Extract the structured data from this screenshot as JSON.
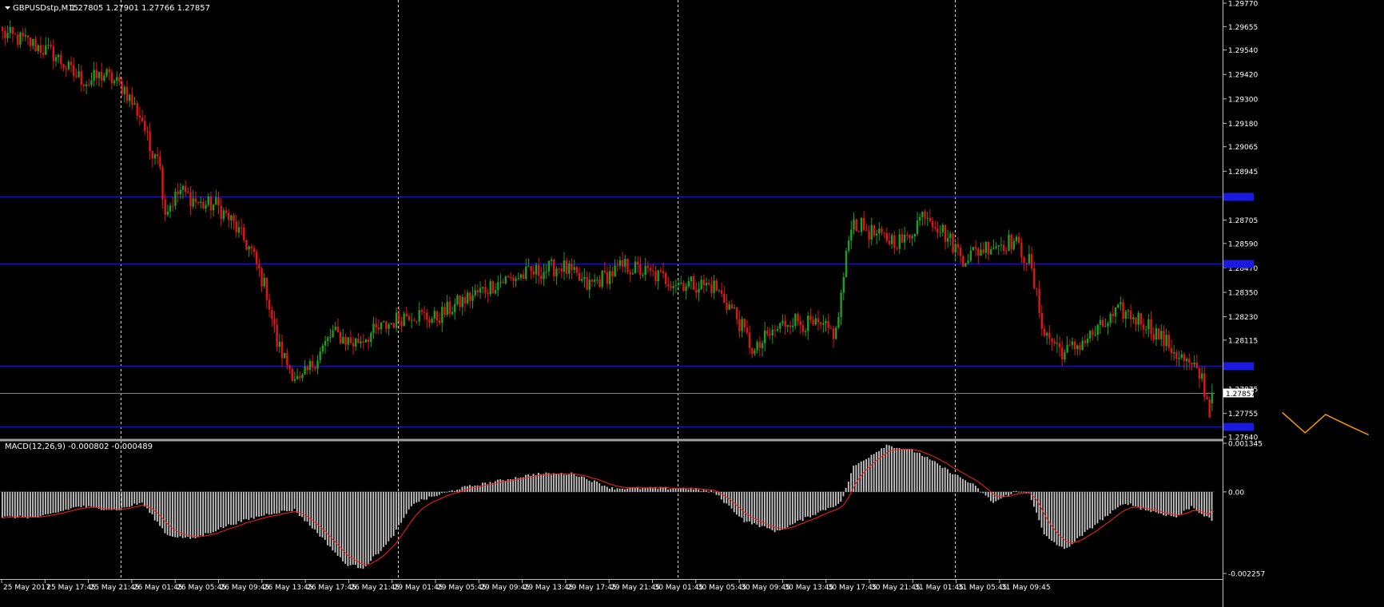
{
  "window": {
    "symbol_timeframe": "GBPUSDstp,M15",
    "ohlc_readout": "1.27805 1.27901 1.27766 1.27857",
    "dropdown_icon": "triangle-down-icon"
  },
  "colors": {
    "background": "#000000",
    "bull": "#1ea01e",
    "bear": "#e41414",
    "hline": "#1010e6",
    "hline_tag": "#1a1ae0",
    "period_sep": "#ffffff",
    "macd_hist": "#c8c8c8",
    "macd_signal": "#ff2020",
    "projection": "#ff9a00",
    "axis": "#c0c0c0",
    "current_price_line": "#808080",
    "current_price_tag_bg": "#ffffff",
    "current_price_tag_text": "#000000"
  },
  "main_chart": {
    "price_ticks": [
      "1.29770",
      "1.29655",
      "1.29540",
      "1.29420",
      "1.29300",
      "1.29180",
      "1.29065",
      "1.28945",
      "1.28705",
      "1.28590",
      "1.28470",
      "1.28350",
      "1.28230",
      "1.28115",
      "1.27875",
      "1.27755",
      "1.27640"
    ],
    "current_price_label": "1.27857"
  },
  "indicator": {
    "label": "MACD(12,26,9) -0.000802 -0.000489",
    "ticks": [
      "0.001345",
      "0.00",
      "-0.002257"
    ]
  },
  "time_axis": {
    "labels": [
      "25 May 2017",
      "25 May 17:45",
      "25 May 21:45",
      "26 May 01:45",
      "26 May 05:45",
      "26 May 09:45",
      "26 May 13:45",
      "26 May 17:45",
      "26 May 21:45",
      "29 May 01:45",
      "29 May 05:45",
      "29 May 09:45",
      "29 May 13:45",
      "29 May 17:45",
      "29 May 21:45",
      "30 May 01:45",
      "30 May 05:45",
      "30 May 09:45",
      "30 May 13:45",
      "30 May 17:45",
      "30 May 21:45",
      "31 May 01:45",
      "31 May 05:45",
      "31 May 09:45"
    ]
  },
  "chart_data": [
    {
      "type": "candlestick",
      "title": "GBPUSDstp,M15",
      "ylim": [
        1.2764,
        1.2977
      ],
      "horizontal_levels": [
        1.2882,
        1.2849,
        1.2799,
        1.2769
      ],
      "current_price": 1.27857,
      "last_bar": {
        "open": 1.27805,
        "high": 1.27901,
        "low": 1.27766,
        "close": 1.27857
      },
      "path": [
        [
          0,
          1.2962
        ],
        [
          10,
          1.2958
        ],
        [
          20,
          1.2952
        ],
        [
          28,
          1.2942
        ],
        [
          34,
          1.2938
        ],
        [
          36,
          1.294
        ],
        [
          40,
          1.2942
        ],
        [
          48,
          1.2935
        ],
        [
          51,
          1.2928
        ],
        [
          55,
          1.292
        ],
        [
          58,
          1.2905
        ],
        [
          61,
          1.2905
        ],
        [
          64,
          1.2875
        ],
        [
          70,
          1.2885
        ],
        [
          78,
          1.2878
        ],
        [
          84,
          1.2878
        ],
        [
          90,
          1.287
        ],
        [
          98,
          1.2855
        ],
        [
          104,
          1.2835
        ],
        [
          108,
          1.281
        ],
        [
          112,
          1.28
        ],
        [
          117,
          1.279
        ],
        [
          122,
          1.28
        ],
        [
          130,
          1.2815
        ],
        [
          138,
          1.281
        ],
        [
          150,
          1.2818
        ],
        [
          160,
          1.2825
        ],
        [
          170,
          1.2822
        ],
        [
          180,
          1.283
        ],
        [
          195,
          1.284
        ],
        [
          210,
          1.2845
        ],
        [
          220,
          1.2848
        ],
        [
          230,
          1.2838
        ],
        [
          245,
          1.2848
        ],
        [
          265,
          1.284
        ],
        [
          280,
          1.2838
        ],
        [
          288,
          1.2825
        ],
        [
          296,
          1.2805
        ],
        [
          300,
          1.2812
        ],
        [
          310,
          1.2822
        ],
        [
          320,
          1.2818
        ],
        [
          328,
          1.2815
        ],
        [
          334,
          1.287
        ],
        [
          345,
          1.2862
        ],
        [
          355,
          1.286
        ],
        [
          363,
          1.2875
        ],
        [
          370,
          1.2865
        ],
        [
          378,
          1.2852
        ],
        [
          388,
          1.2858
        ],
        [
          398,
          1.286
        ],
        [
          404,
          1.285
        ],
        [
          410,
          1.2815
        ],
        [
          418,
          1.2805
        ],
        [
          430,
          1.2815
        ],
        [
          440,
          1.2826
        ],
        [
          450,
          1.282
        ],
        [
          462,
          1.2805
        ],
        [
          472,
          1.2793
        ],
        [
          476,
          1.277
        ]
      ]
    },
    {
      "type": "line",
      "name": "projection",
      "x": [
        504,
        513,
        521,
        531,
        538
      ],
      "y": [
        1.2776,
        1.2766,
        1.2775,
        1.2769,
        1.2765
      ]
    },
    {
      "type": "bar",
      "title": "MACD(12,26,9) -0.000802 -0.000489",
      "macd": -0.000802,
      "signal": -0.000489,
      "ylim": [
        -0.002257,
        0.001345
      ],
      "path": [
        [
          0,
          -0.0007
        ],
        [
          15,
          -0.0007
        ],
        [
          30,
          -0.0004
        ],
        [
          45,
          -0.0005
        ],
        [
          55,
          -0.0003
        ],
        [
          65,
          -0.0012
        ],
        [
          75,
          -0.0013
        ],
        [
          90,
          -0.0009
        ],
        [
          105,
          -0.0006
        ],
        [
          115,
          -0.0005
        ],
        [
          125,
          -0.0012
        ],
        [
          135,
          -0.002
        ],
        [
          142,
          -0.0021
        ],
        [
          152,
          -0.0014
        ],
        [
          162,
          -0.0003
        ],
        [
          180,
          0.0001
        ],
        [
          195,
          0.0003
        ],
        [
          210,
          0.0005
        ],
        [
          225,
          0.0005
        ],
        [
          240,
          0.0001
        ],
        [
          255,
          0.0001
        ],
        [
          270,
          0.0001
        ],
        [
          280,
          0.0
        ],
        [
          292,
          -0.0008
        ],
        [
          305,
          -0.0011
        ],
        [
          320,
          -0.0006
        ],
        [
          330,
          -0.0003
        ],
        [
          335,
          0.0007
        ],
        [
          348,
          0.0013
        ],
        [
          360,
          0.0011
        ],
        [
          372,
          0.0006
        ],
        [
          382,
          0.0002
        ],
        [
          390,
          -0.0003
        ],
        [
          398,
          0.0
        ],
        [
          404,
          0.0
        ],
        [
          410,
          -0.0012
        ],
        [
          418,
          -0.0016
        ],
        [
          432,
          -0.0008
        ],
        [
          442,
          -0.0003
        ],
        [
          450,
          -0.0005
        ],
        [
          462,
          -0.0007
        ],
        [
          468,
          -0.0004
        ],
        [
          476,
          -0.0008
        ]
      ]
    }
  ]
}
